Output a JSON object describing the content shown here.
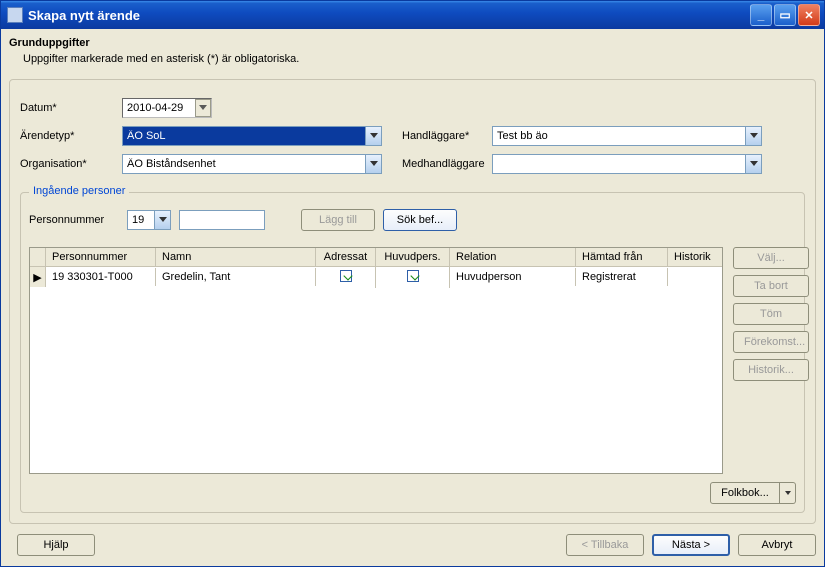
{
  "window": {
    "title": "Skapa nytt ärende"
  },
  "header": {
    "section": "Grunduppgifter",
    "note": "Uppgifter markerade med en asterisk (*) är obligatoriska."
  },
  "labels": {
    "datum": "Datum*",
    "arendetyp": "Ärendetyp*",
    "organisation": "Organisation*",
    "handlaggare": "Handläggare*",
    "medhandlaggare": "Medhandläggare"
  },
  "values": {
    "datum": "2010-04-29",
    "arendetyp": "ÄO SoL",
    "organisation": "ÄO Biståndsenhet",
    "handlaggare": "Test bb äo",
    "medhandlaggare": ""
  },
  "persons": {
    "legend": "Ingående personer",
    "label_personnummer": "Personnummer",
    "prefix_selected": "19",
    "input_value": "",
    "btn_add": "Lägg till",
    "btn_sok": "Sök bef..."
  },
  "table": {
    "cols": {
      "pn": "Personnummer",
      "nm": "Namn",
      "ad": "Adressat",
      "hp": "Huvudpers.",
      "rel": "Relation",
      "hf": "Hämtad från",
      "hi": "Historik"
    },
    "rows": [
      {
        "pn": "19 330301-T000",
        "nm": "Gredelin, Tant",
        "ad": true,
        "hp": true,
        "rel": "Huvudperson",
        "hf": "Registrerat",
        "hi": ""
      }
    ]
  },
  "sidebuttons": {
    "valj": "Välj...",
    "tabort": "Ta bort",
    "tom": "Töm",
    "forekomst": "Förekomst...",
    "historik": "Historik..."
  },
  "folkbok": "Folkbok...",
  "footer": {
    "hjalp": "Hjälp",
    "tillbaka": "< Tillbaka",
    "nasta": "Nästa >",
    "avbryt": "Avbryt"
  }
}
